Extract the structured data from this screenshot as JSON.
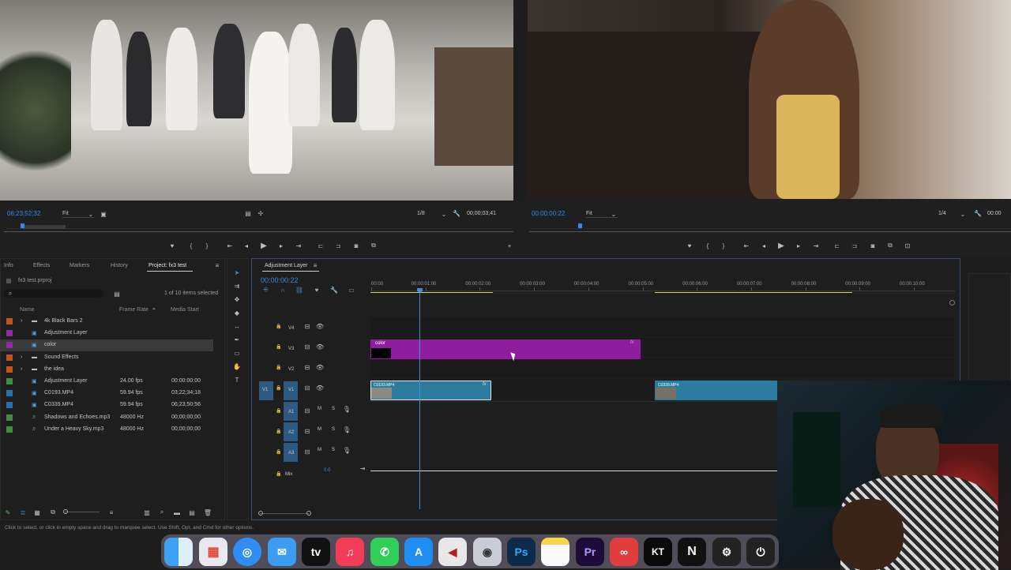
{
  "source_monitor": {
    "timecode": "06;23;52;32",
    "fit": "Fit",
    "resolution": "1/8",
    "duration": "00;00;03;41"
  },
  "program_monitor": {
    "timecode": "00:00:00:22",
    "fit": "Fit",
    "resolution": "1/4",
    "duration": "00:00"
  },
  "project_panel": {
    "tabs": [
      "Info",
      "Effects",
      "Markers",
      "History",
      "Project: fx3 test"
    ],
    "project_file": "fx3 test.prproj",
    "search_placeholder": "",
    "selection_info": "1 of 10 items selected",
    "columns": {
      "name": "Name",
      "frame_rate": "Frame Rate",
      "media_start": "Media Start"
    },
    "items": [
      {
        "name": "4k Black Bars 2",
        "type": "folder",
        "color": "#c0561f",
        "frame_rate": "",
        "media_start": ""
      },
      {
        "name": "Adjustment Layer",
        "type": "item",
        "color": "#8e2ba3",
        "frame_rate": "",
        "media_start": ""
      },
      {
        "name": "color",
        "type": "item",
        "color": "#8e2ba3",
        "frame_rate": "",
        "media_start": ""
      },
      {
        "name": "Sound Effects",
        "type": "folder",
        "color": "#c0561f",
        "frame_rate": "",
        "media_start": ""
      },
      {
        "name": "the idea",
        "type": "folder",
        "color": "#c0561f",
        "frame_rate": "",
        "media_start": ""
      },
      {
        "name": "Adjustment Layer",
        "type": "item",
        "color": "#3f8f3f",
        "frame_rate": "24.00 fps",
        "media_start": "00:00:00:00"
      },
      {
        "name": "C0193.MP4",
        "type": "clip",
        "color": "#2a6fa8",
        "frame_rate": "59.94 fps",
        "media_start": "03;22;34;18"
      },
      {
        "name": "C0339.MP4",
        "type": "clip",
        "color": "#2a6fa8",
        "frame_rate": "59.94 fps",
        "media_start": "06;23;50;56"
      },
      {
        "name": "Shadows and Echoes.mp3",
        "type": "audio",
        "color": "#3f8f3f",
        "frame_rate": "48000 Hz",
        "media_start": "00;00;00;00"
      },
      {
        "name": "Under a Heavy Sky.mp3",
        "type": "audio",
        "color": "#3f8f3f",
        "frame_rate": "48000 Hz",
        "media_start": "00;00;00;00"
      }
    ]
  },
  "timeline": {
    "sequence_name": "Adjustment Layer",
    "timecode": "00:00:00:22",
    "ruler": [
      "00:00",
      "00:00:01:00",
      "00:00:02:00",
      "00:00:03:00",
      "00:00:04:00",
      "00:00:05:00",
      "00:00:06:00",
      "00:00:07:00",
      "00:00:08:00",
      "00:00:09:00",
      "00:00:10:00"
    ],
    "tracks": {
      "v4": "V4",
      "v3": "V3",
      "v2": "V2",
      "v1": "V1",
      "v1_src": "V1",
      "a1": "A1",
      "a2": "A2",
      "a3": "A3",
      "mix": "Mix",
      "mix_value": "0.0",
      "mute": "M",
      "solo": "S"
    },
    "clips": {
      "color_clip": "color",
      "fx": "fx",
      "clip1": "C0193.MP4",
      "clip2": "C0339.MP4"
    }
  },
  "status_bar": "Click to select, or click in empty space and drag to marquee select. Use Shift, Opt, and Cmd for other options.",
  "dock": [
    "Finder",
    "Launchpad",
    "Safari",
    "Mail",
    "Apple TV",
    "Music",
    "WhatsApp",
    "App Store",
    "Cubase",
    "Compressor",
    "Photoshop",
    "Notes",
    "Premiere Pro",
    "Creative Cloud",
    "KT",
    "Notion",
    "Mixer",
    "Other"
  ],
  "dock_labels": {
    "tv": "tv",
    "ps": "Ps",
    "pr": "Pr",
    "kt": "KT",
    "n": "N"
  }
}
